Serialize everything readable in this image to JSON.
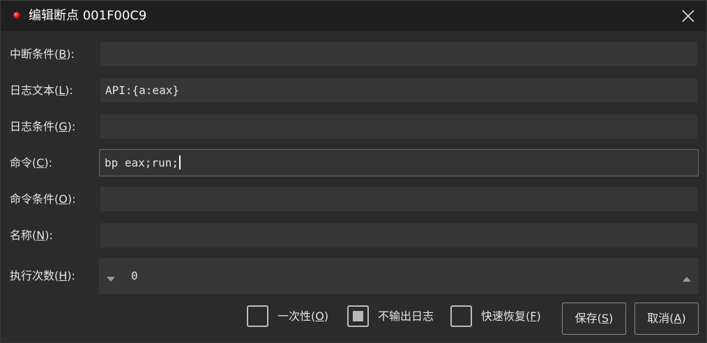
{
  "window": {
    "title": "编辑断点 001F00C9",
    "close_icon": "close-icon"
  },
  "rows": [
    {
      "label_pre": "中断条件(",
      "key": "B",
      "label_post": "):",
      "value": ""
    },
    {
      "label_pre": "日志文本(",
      "key": "L",
      "label_post": "):",
      "value": "API:{a:eax}"
    },
    {
      "label_pre": "日志条件(",
      "key": "G",
      "label_post": "):",
      "value": ""
    },
    {
      "label_pre": "命令(",
      "key": "C",
      "label_post": "):",
      "value": "bp eax;run;"
    },
    {
      "label_pre": "命令条件(",
      "key": "O",
      "label_post": "):",
      "value": ""
    },
    {
      "label_pre": "名称(",
      "key": "N",
      "label_post": "):",
      "value": ""
    }
  ],
  "hit_count": {
    "label_pre": "执行次数(",
    "key": "H",
    "label_post": "):",
    "value": "0"
  },
  "options": [
    {
      "label_pre": "一次性(",
      "key": "O",
      "label_post": ")",
      "checked": false
    },
    {
      "label_pre": "不输出日志",
      "key": "",
      "label_post": "",
      "checked": true
    },
    {
      "label_pre": "快速恢复(",
      "key": "F",
      "label_post": ")",
      "checked": false
    }
  ],
  "buttons": {
    "save": {
      "label_pre": "保存(",
      "key": "S",
      "label_post": ")"
    },
    "cancel": {
      "label_pre": "取消(",
      "key": "A",
      "label_post": ")"
    }
  },
  "colors": {
    "title_dot": "#e01010",
    "background": "#2b2b2b",
    "field": "#363636"
  }
}
